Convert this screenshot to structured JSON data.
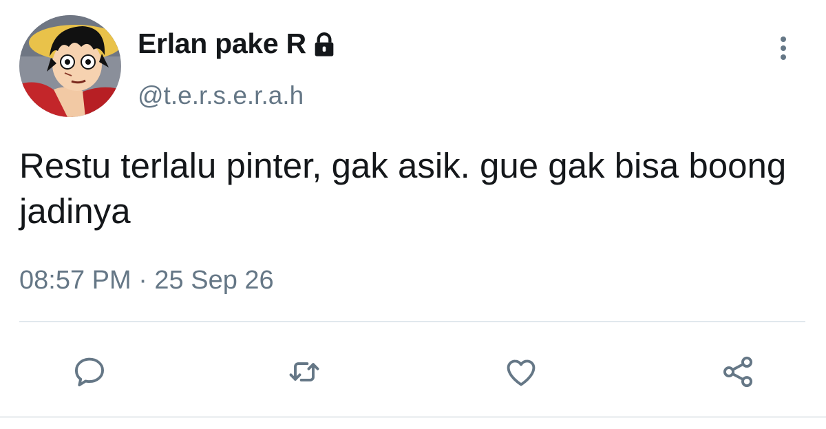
{
  "user": {
    "display_name": "Erlan pake R",
    "handle": "@t.e.r.s.e.r.a.h",
    "protected_icon": "lock-icon",
    "avatar_icon": "cartoon-character-avatar"
  },
  "tweet": {
    "text": "Restu terlalu pinter, gak asik. gue gak bisa boong jadinya",
    "timestamp": "08:57 PM · 25 Sep 26"
  },
  "actions": {
    "reply_icon": "reply-icon",
    "retweet_icon": "retweet-icon",
    "like_icon": "heart-icon",
    "share_icon": "share-icon",
    "more_icon": "more-vertical-icon"
  },
  "colors": {
    "text_primary": "#14171a",
    "text_secondary": "#657786",
    "icon": "#657786",
    "divider": "#e1e8ed",
    "background": "#ffffff"
  }
}
